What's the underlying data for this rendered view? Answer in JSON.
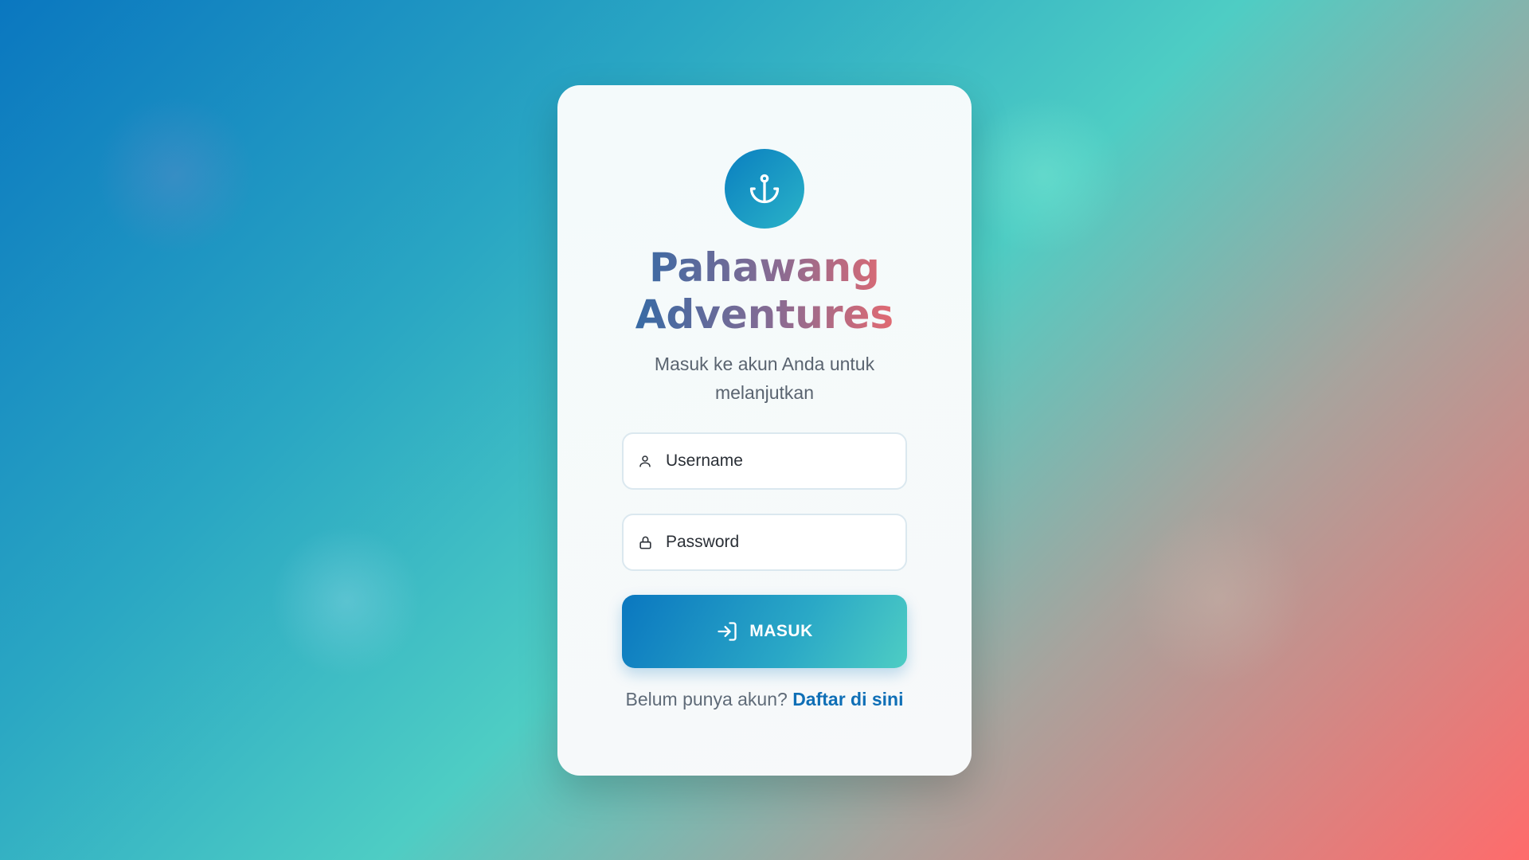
{
  "app": {
    "name": "Pahawang Adventures",
    "subtitle": "Masuk ke akun Anda untuk melanjutkan",
    "logo_icon": "anchor-icon"
  },
  "form": {
    "username": {
      "placeholder": "Username",
      "value": "",
      "icon": "user-icon"
    },
    "password": {
      "placeholder": "Password",
      "value": "",
      "icon": "lock-icon"
    },
    "submit": {
      "label": "MASUK",
      "icon": "login-icon"
    }
  },
  "footer": {
    "prompt": "Belum punya akun?",
    "link_label": "Daftar di sini"
  },
  "colors": {
    "accent": "#0A77C0",
    "accent_secondary": "#4ECDC4",
    "highlight": "#FF6B6B",
    "link": "#0F6FB6"
  }
}
